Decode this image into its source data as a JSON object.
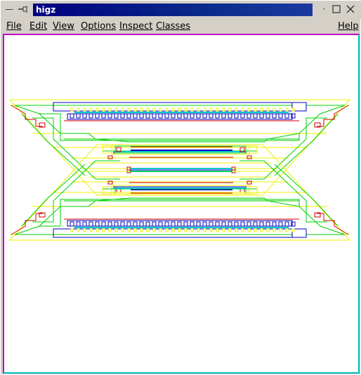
{
  "window": {
    "title": "higz"
  },
  "titlebar": {
    "minimize_icon": "minus-icon",
    "pin_icon": "pin-icon",
    "restore_icon": "square-icon",
    "close_icon": "close-icon",
    "dot_icon": "dot-icon"
  },
  "menu": {
    "file": "File",
    "edit": "Edit",
    "view": "View",
    "options": "Options",
    "inspect": "Inspect",
    "classes": "Classes",
    "help": "Help"
  },
  "colors": {
    "yellow": "#f0f000",
    "green": "#00d000",
    "red": "#d00000",
    "blue": "#0000c0",
    "cyan": "#00c8c8"
  }
}
